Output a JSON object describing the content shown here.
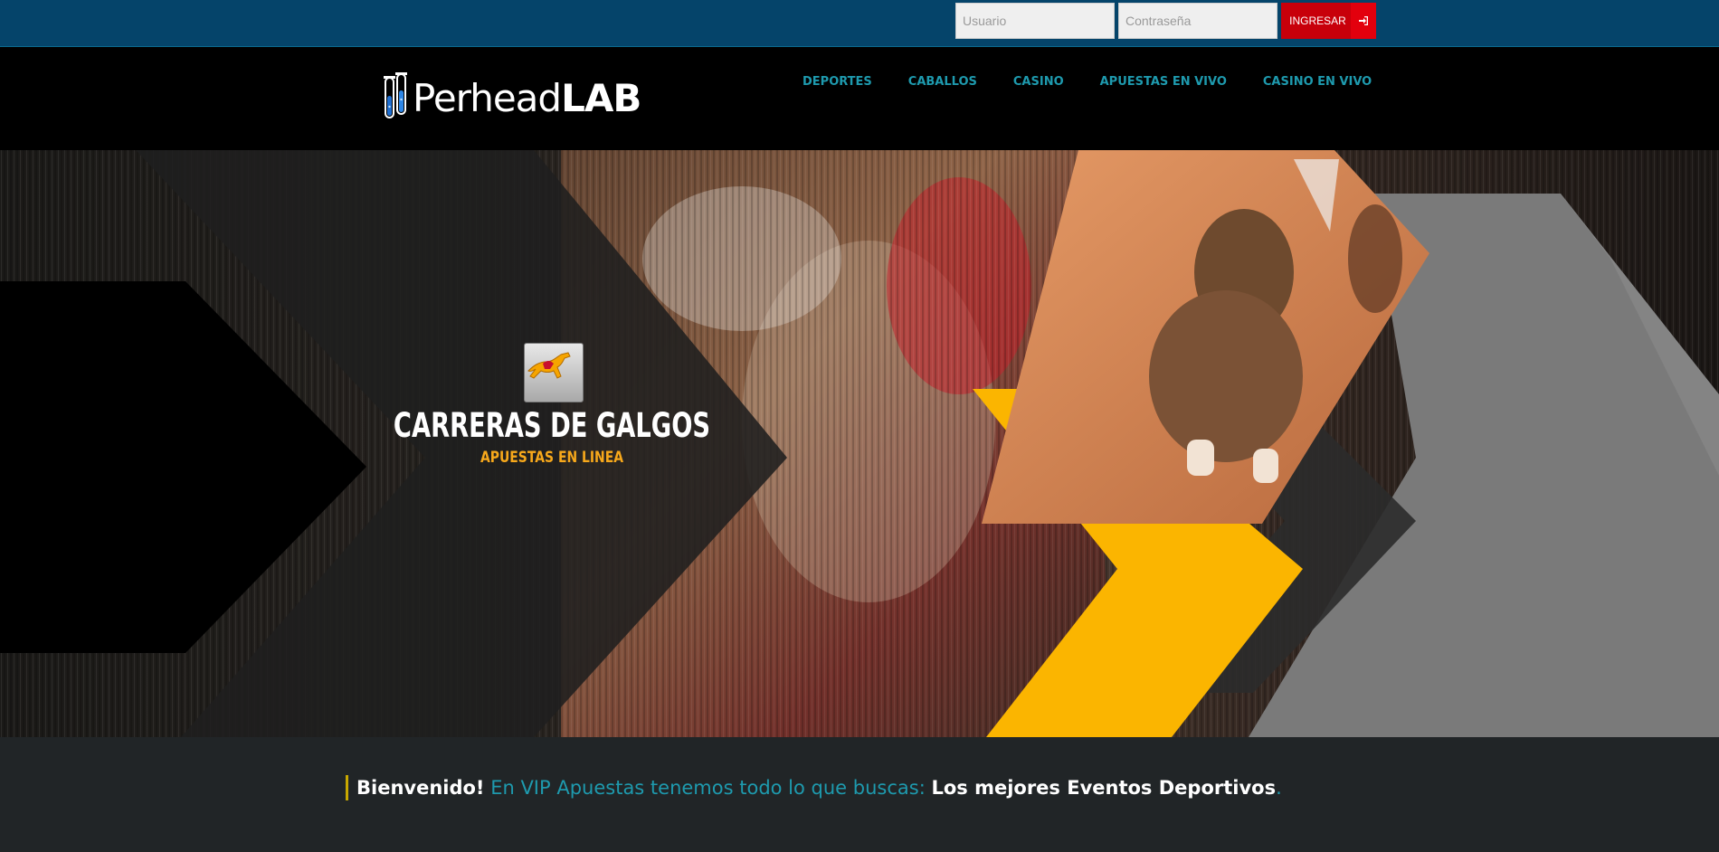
{
  "login": {
    "username_placeholder": "Usuario",
    "password_placeholder": "Contraseña",
    "submit_label": "INGRESAR",
    "submit_icon": "sign-in-icon"
  },
  "logo": {
    "text_regular": "Perhead",
    "text_bold": "LAB",
    "icon": "test-tubes-icon"
  },
  "nav": {
    "items": [
      {
        "label": "DEPORTES"
      },
      {
        "label": "CABALLOS"
      },
      {
        "label": "CASINO"
      },
      {
        "label": "APUESTAS EN VIVO"
      },
      {
        "label": "CASINO EN VIVO"
      }
    ]
  },
  "hero": {
    "badge_icon": "greyhound-icon",
    "title": "CARRERAS DE GALGOS",
    "subtitle": "APUESTAS EN LINEA"
  },
  "welcome": {
    "greeting": "Bienvenido!",
    "text": " En VIP Apuestas tenemos todo lo que buscas: ",
    "highlight": "Los mejores Eventos Deportivos",
    "end": "."
  },
  "colors": {
    "topbar": "#05446a",
    "nav_link": "#1e9aae",
    "login_button": "#c8000a",
    "accent_yellow": "#fbb500",
    "hero_subtitle": "#f7a81b",
    "welcome_bg": "#212527"
  }
}
